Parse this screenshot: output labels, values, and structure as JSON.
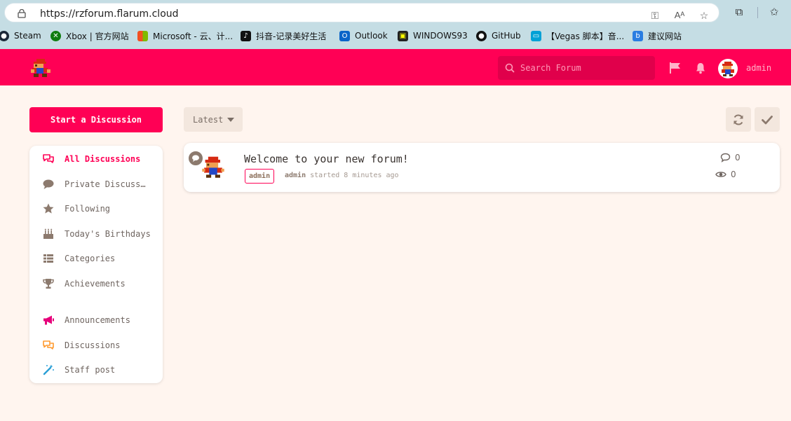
{
  "browser": {
    "url": "https://rzforum.flarum.cloud",
    "bookmarks": [
      {
        "label": "Steam",
        "icon": "steam-icon"
      },
      {
        "label": "Xbox | 官方网站",
        "icon": "xbox-icon"
      },
      {
        "label": "Microsoft - 云、计...",
        "icon": "microsoft-icon"
      },
      {
        "label": "抖音-记录美好生活",
        "icon": "tiktok-icon"
      },
      {
        "label": "Outlook",
        "icon": "outlook-icon"
      },
      {
        "label": "WINDOWS93",
        "icon": "windows93-icon"
      },
      {
        "label": "GitHub",
        "icon": "github-icon"
      },
      {
        "label": "【Vegas 脚本】音...",
        "icon": "bilibili-icon"
      },
      {
        "label": "建议网站",
        "icon": "bing-icon"
      }
    ]
  },
  "header": {
    "search_placeholder": "Search Forum",
    "username": "admin",
    "accent": "#ff0055"
  },
  "sidebar": {
    "start_label": "Start a Discussion",
    "items": [
      {
        "label": "All Discussions",
        "icon": "comments-icon",
        "active": true
      },
      {
        "label": "Private Discussions",
        "icon": "comment-icon"
      },
      {
        "label": "Following",
        "icon": "star-icon"
      },
      {
        "label": "Today's Birthdays",
        "icon": "cake-icon"
      },
      {
        "label": "Categories",
        "icon": "list-icon"
      },
      {
        "label": "Achievements",
        "icon": "trophy-icon"
      },
      {
        "label": "Announcements",
        "icon": "megaphone-icon"
      },
      {
        "label": "Discussions",
        "icon": "comments-icon"
      },
      {
        "label": "Staff post",
        "icon": "wand-icon"
      }
    ]
  },
  "toolbar": {
    "sort_label": "Latest"
  },
  "discussions": [
    {
      "title": "Welcome to your new forum!",
      "tag": "admin",
      "author": "admin",
      "meta_text": "started 8 minutes ago",
      "replies": "0",
      "views": "0"
    }
  ]
}
